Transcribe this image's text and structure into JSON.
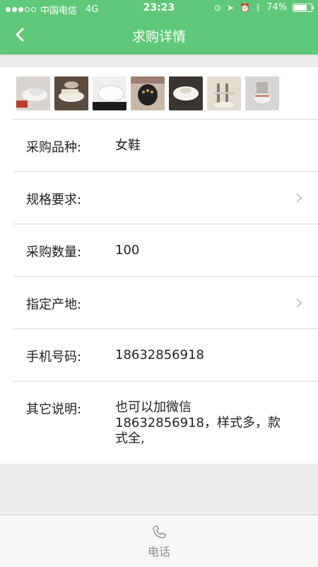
{
  "status_bar": {
    "carrier": "中国电信",
    "network": "4G",
    "time": "23:23",
    "battery": "74%",
    "battery_level": 0.74
  },
  "nav": {
    "title": "求购详情",
    "back_icon": "chevron-left-icon"
  },
  "gallery": {
    "images": [
      "shoe-image-1",
      "shoe-image-2",
      "shoe-image-3",
      "shoe-image-4",
      "shoe-image-5",
      "shoe-image-6",
      "shoe-image-7"
    ]
  },
  "details": [
    {
      "label": "采购品种:",
      "value": "女鞋"
    },
    {
      "label": "规格要求:",
      "value": ""
    },
    {
      "label": "采购数量:",
      "value": "100"
    },
    {
      "label": "指定产地:",
      "value": ""
    },
    {
      "label": "手机号码:",
      "value": "18632856918"
    },
    {
      "label": "其它说明:",
      "value": "也可以加微信",
      "value_line2": "18632856918，样式多，款",
      "value_line3": "式全,"
    }
  ],
  "bottom_bar": {
    "call_label": "电话",
    "call_icon": "phone-icon"
  },
  "colors": {
    "header": "#5fc878",
    "background": "#eeeef0"
  }
}
